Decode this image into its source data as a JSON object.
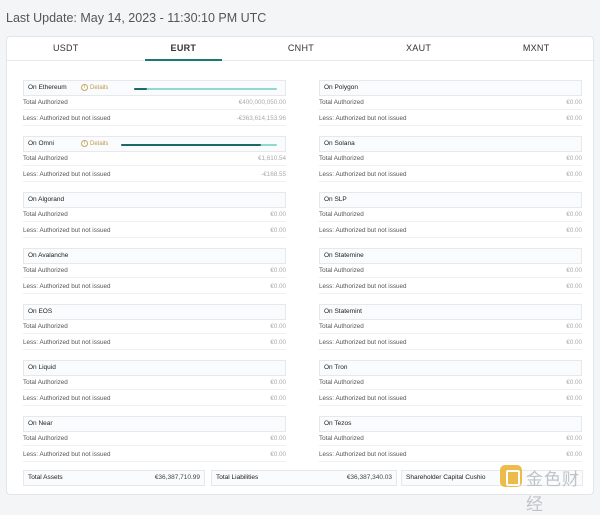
{
  "last_update": "Last Update: May 14, 2023 - 11:30:10 PM UTC",
  "tabs": [
    {
      "label": "USDT"
    },
    {
      "label": "EURT",
      "active": true
    },
    {
      "label": "CNHT"
    },
    {
      "label": "XAUT"
    },
    {
      "label": "MXNT"
    }
  ],
  "row_labels": {
    "total": "Total Authorized",
    "less": "Less: Authorized but not issued"
  },
  "details_label": "Details",
  "left": [
    {
      "chain": "On Ethereum",
      "has_details": true,
      "issued_fraction": 0.09,
      "total": "€400,000,050.00",
      "less": "-€363,614,153.96"
    },
    {
      "chain": "On Omni",
      "has_details": true,
      "issued_fraction": 0.9,
      "total": "€1,610.54",
      "less": "-€168.55"
    },
    {
      "chain": "On Algorand",
      "total": "€0.00",
      "less": "€0.00"
    },
    {
      "chain": "On Avalanche",
      "total": "€0.00",
      "less": "€0.00"
    },
    {
      "chain": "On EOS",
      "total": "€0.00",
      "less": "€0.00"
    },
    {
      "chain": "On Liquid",
      "total": "€0.00",
      "less": "€0.00"
    },
    {
      "chain": "On Near",
      "total": "€0.00",
      "less": "€0.00"
    }
  ],
  "right": [
    {
      "chain": "On Polygon",
      "total": "€0.00",
      "less": "€0.00"
    },
    {
      "chain": "On Solana",
      "total": "€0.00",
      "less": "€0.00"
    },
    {
      "chain": "On SLP",
      "total": "€0.00",
      "less": "€0.00"
    },
    {
      "chain": "On Statemine",
      "total": "€0.00",
      "less": "€0.00"
    },
    {
      "chain": "On Statemint",
      "total": "€0.00",
      "less": "€0.00"
    },
    {
      "chain": "On Tron",
      "total": "€0.00",
      "less": "€0.00"
    },
    {
      "chain": "On Tezos",
      "total": "€0.00",
      "less": "€0.00"
    }
  ],
  "footer": {
    "total_assets_label": "Total Assets",
    "total_assets": "€36,387,710.99",
    "total_liabilities_label": "Total Liabilities",
    "total_liabilities": "€36,387,340.03",
    "shareholder_label": "Shareholder Capital Cushio"
  },
  "watermark": {
    "text": "金色财经"
  }
}
